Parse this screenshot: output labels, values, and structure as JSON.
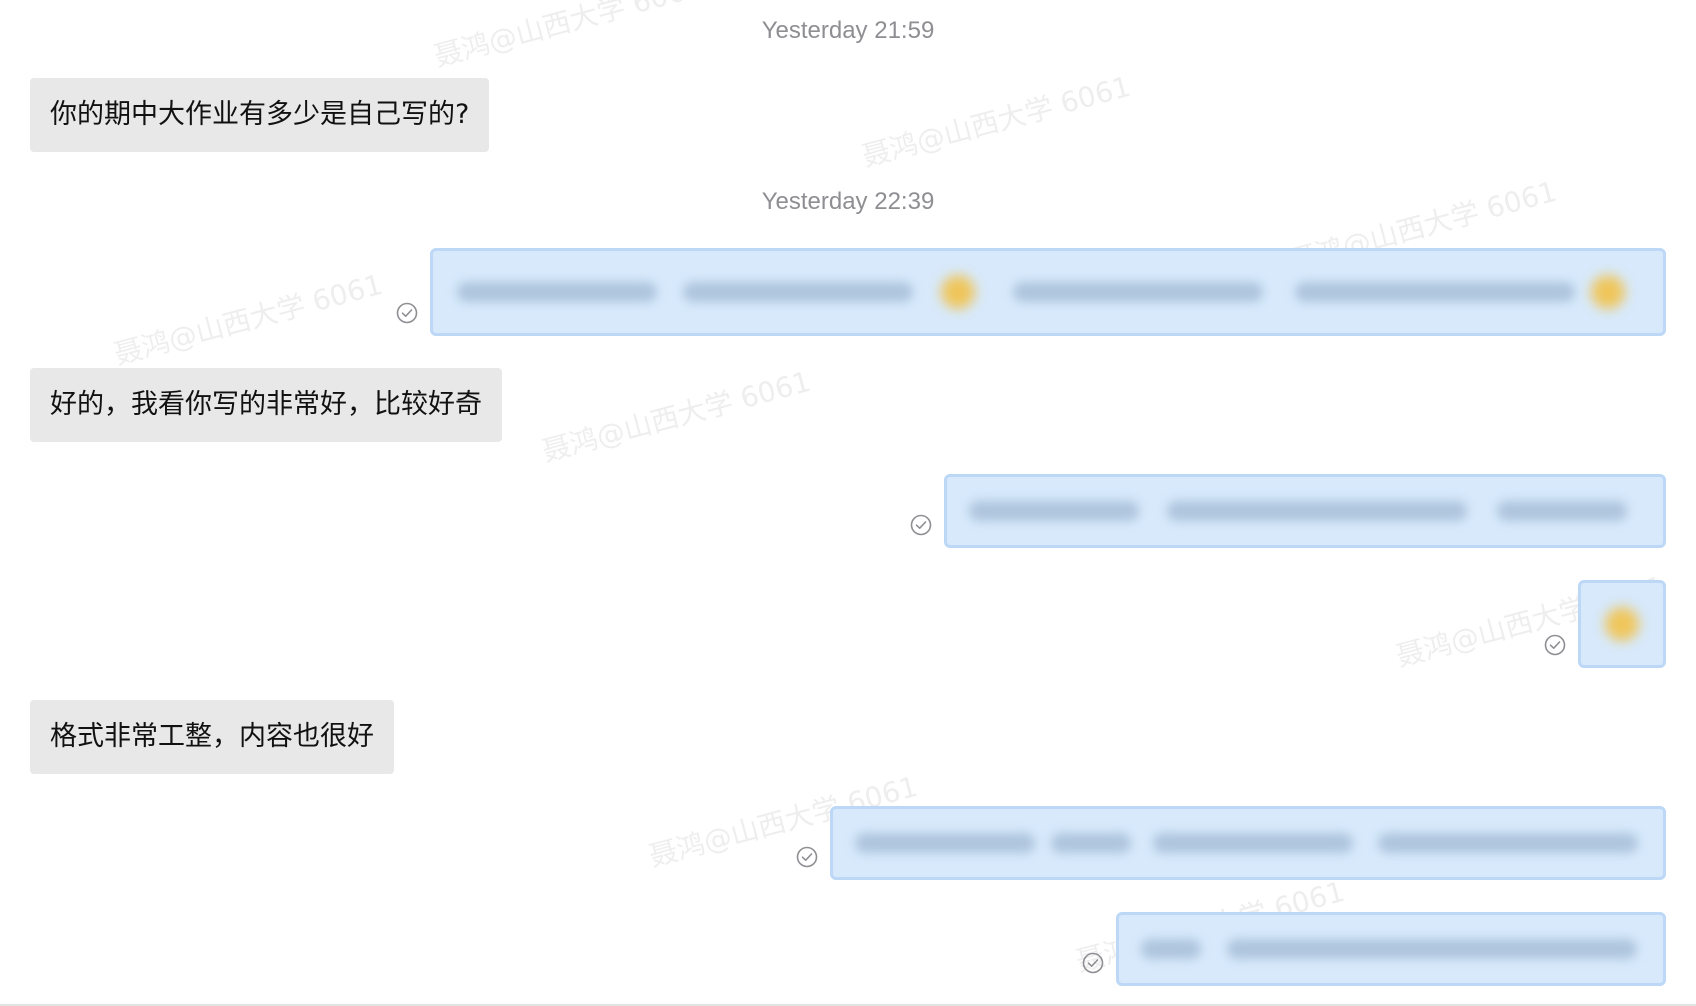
{
  "timestamps": {
    "first": "Yesterday 21:59",
    "second": "Yesterday 22:39"
  },
  "incoming": {
    "msg1": "你的期中大作业有多少是自己写的?",
    "msg2": "好的，我看你写的非常好，比较好奇",
    "msg3": "格式非常工整，内容也很好"
  },
  "watermark_text": "聂鸿@山西大学 6061",
  "icons": {
    "read_receipt": "check-circle-icon"
  },
  "colors": {
    "incoming_bubble": "#e8e8e8",
    "outgoing_bubble": "#d7e9fb",
    "outgoing_border": "#bcd8f6",
    "timestamp_text": "#8e8e93"
  }
}
